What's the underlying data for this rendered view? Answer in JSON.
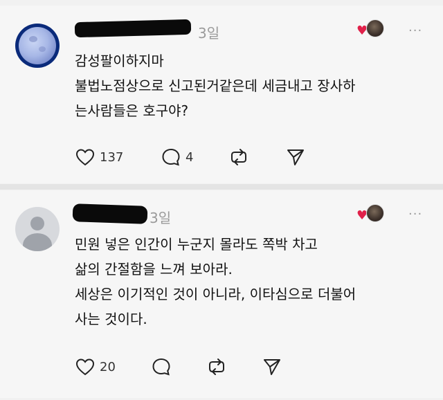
{
  "colors": {
    "heart": "#e0214a",
    "muted_text": "#9a9a9a",
    "background": "#f6f6f6"
  },
  "posts": [
    {
      "author_redacted": true,
      "time": "3일",
      "lines": [
        "감성팔이하지마",
        "불법노점상으로 신고된거같은데 세금내고 장사하",
        "는사람들은 호구야?"
      ],
      "likes": "137",
      "comments": "4",
      "more_icon": "···"
    },
    {
      "author_redacted": true,
      "time": "3일",
      "lines": [
        "민원 넣은 인간이 누군지 몰라도 쪽박 차고",
        "삶의 간절함을 느껴 보아라.",
        "세상은 이기적인 것이 아니라, 이타심으로 더불어",
        "사는 것이다."
      ],
      "likes": "20",
      "more_icon": "···"
    }
  ],
  "icons": [
    "heart-icon",
    "comment-icon",
    "repost-icon",
    "share-icon",
    "more-icon"
  ]
}
